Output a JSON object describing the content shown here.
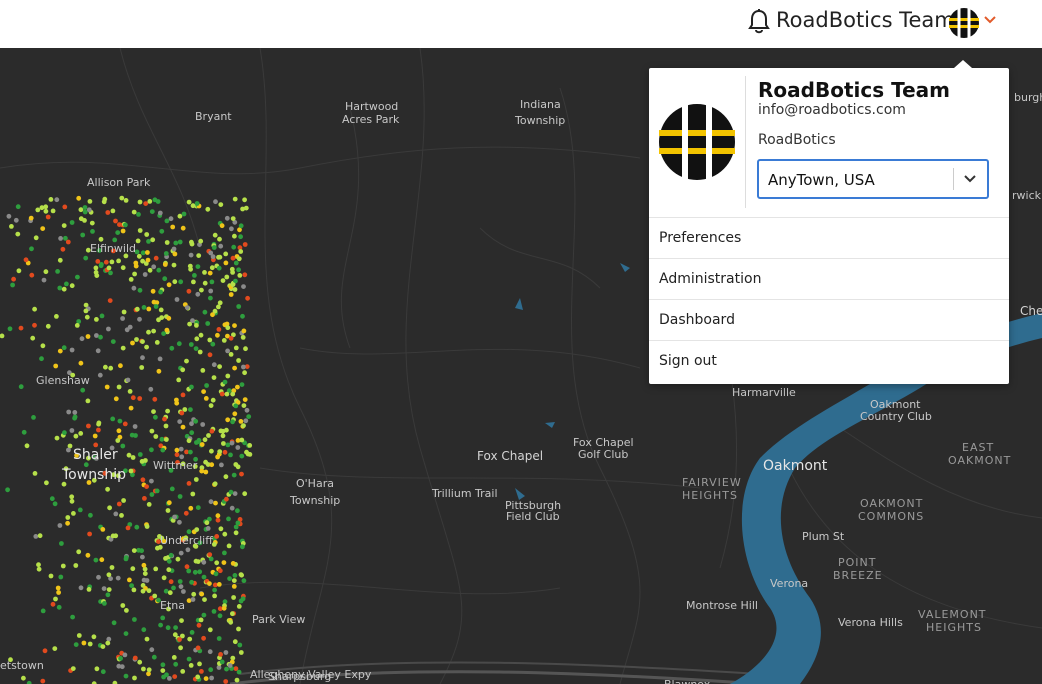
{
  "header": {
    "user_name": "RoadBotics Team",
    "icons": {
      "notifications": "bell-icon",
      "account": "roadbotics-logo",
      "menu": "chevron-down-icon"
    },
    "accent_color": "#e25b2b"
  },
  "account_menu": {
    "name": "RoadBotics Team",
    "email": "info@roadbotics.com",
    "organization": "RoadBotics",
    "location_select": {
      "selected": "AnyTown, USA"
    },
    "items": [
      {
        "label": "Preferences"
      },
      {
        "label": "Administration"
      },
      {
        "label": "Dashboard"
      },
      {
        "label": "Sign out"
      }
    ]
  },
  "map": {
    "labels": [
      {
        "text": "Bryant"
      },
      {
        "text": "Hartwood"
      },
      {
        "text": "Acres Park"
      },
      {
        "text": "Indiana"
      },
      {
        "text": "Township"
      },
      {
        "text": "Allison Park"
      },
      {
        "text": "Elfinwild"
      },
      {
        "text": "Glenshaw"
      },
      {
        "text": "Shaler"
      },
      {
        "text": "Township"
      },
      {
        "text": "Wittmer"
      },
      {
        "text": "O'Hara"
      },
      {
        "text": "Township"
      },
      {
        "text": "Undercliff"
      },
      {
        "text": "Etna"
      },
      {
        "text": "Park View"
      },
      {
        "text": "Sharpsburg"
      },
      {
        "text": "Fox Chapel"
      },
      {
        "text": "Trillium Trail"
      },
      {
        "text": "Fox Chapel"
      },
      {
        "text": "Golf Club"
      },
      {
        "text": "Pittsburgh"
      },
      {
        "text": "Field Club"
      },
      {
        "text": "Harmarville"
      },
      {
        "text": "FAIRVIEW"
      },
      {
        "text": "HEIGHTS"
      },
      {
        "text": "Oakmont"
      },
      {
        "text": "Oakmont"
      },
      {
        "text": "Country Club"
      },
      {
        "text": "EAST"
      },
      {
        "text": "OAKMONT"
      },
      {
        "text": "OAKMONT"
      },
      {
        "text": "COMMONS"
      },
      {
        "text": "Plum St"
      },
      {
        "text": "POINT"
      },
      {
        "text": "BREEZE"
      },
      {
        "text": "Verona"
      },
      {
        "text": "Montrose Hill"
      },
      {
        "text": "Verona Hills"
      },
      {
        "text": "VALEMONT"
      },
      {
        "text": "HEIGHTS"
      },
      {
        "text": "burgh"
      },
      {
        "text": "rwick"
      },
      {
        "text": "Che"
      },
      {
        "text": "etstown"
      },
      {
        "text": "Allegheny Valley Expy"
      },
      {
        "text": "Blawnox"
      }
    ],
    "colors": {
      "land": "#2b2b2b",
      "water": "#2f6c8f",
      "roads": "#3b3b3b",
      "good": "#2e9e3e",
      "fair": "#b6e04a",
      "poor": "#f0c419",
      "bad": "#e24a1e"
    }
  }
}
